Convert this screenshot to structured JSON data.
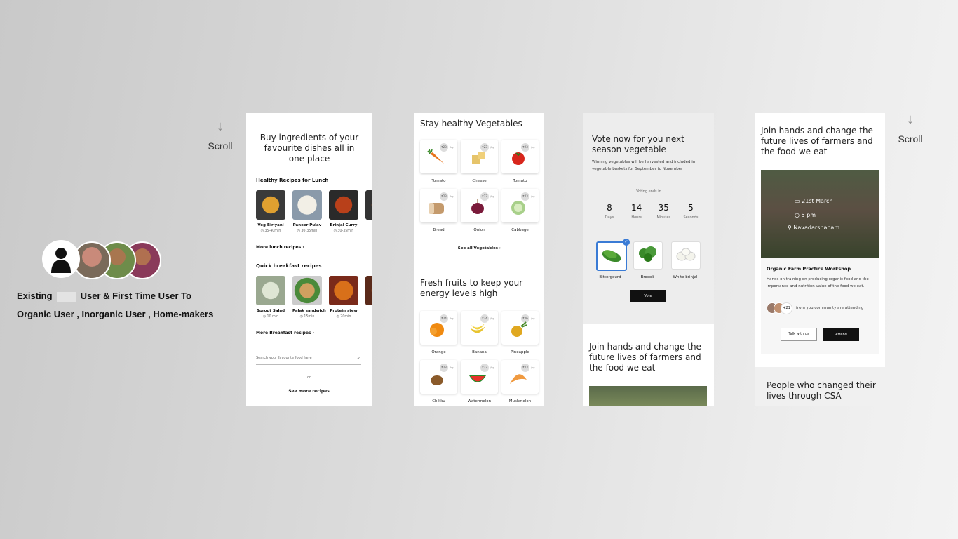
{
  "scroll_left": {
    "label": "Scroll"
  },
  "scroll_right": {
    "label": "Scroll"
  },
  "persona": {
    "line1_prefix": "Existing",
    "line1_suffix": "User & First Time User To",
    "line2": "Organic User , Inorganic User , Home-makers"
  },
  "screen1": {
    "title": "Buy ingredients of your favourite dishes all in one place",
    "lunch_title": "Healthy Recipes for Lunch",
    "lunch": [
      {
        "name": "Veg Biriyani",
        "time": "35-40min"
      },
      {
        "name": "Paneer Pulav",
        "time": "30-35min"
      },
      {
        "name": "Brinjal Curry",
        "time": "30-35min"
      },
      {
        "name": "Ve",
        "time": ""
      }
    ],
    "more_lunch": "More lunch recipes ›",
    "breakfast_title": "Quick breakfast recipes",
    "breakfast": [
      {
        "name": "Sprout Salad",
        "time": "10 min"
      },
      {
        "name": "Palak sandwich",
        "time": "15min"
      },
      {
        "name": "Protein stew",
        "time": "20min"
      },
      {
        "name": "Pr",
        "time": ""
      }
    ],
    "more_breakfast": "More Breakfast recipes ›",
    "search_placeholder": "Search your favourite food here",
    "or": "or",
    "see_more": "See more recipes"
  },
  "screen2": {
    "veg_title": "Stay healthy Vegetables",
    "vegetables": [
      {
        "name": "Tomato",
        "price": "₹23",
        "unit": "/kg",
        "icon": "carrot-icon"
      },
      {
        "name": "Cheese",
        "price": "₹23",
        "unit": "/kg",
        "icon": "cheese-icon"
      },
      {
        "name": "Tomato",
        "price": "₹23",
        "unit": "/kg",
        "icon": "tomato-icon"
      },
      {
        "name": "Bread",
        "price": "₹23",
        "unit": "/kg",
        "icon": "bread-icon"
      },
      {
        "name": "Onion",
        "price": "₹23",
        "unit": "/kg",
        "icon": "onion-icon"
      },
      {
        "name": "Cabbage",
        "price": "₹23",
        "unit": "/kg",
        "icon": "cabbage-icon"
      }
    ],
    "see_all": "See all Vegetables ›",
    "fruit_title": "Fresh fruits to keep your energy levels high",
    "fruits": [
      {
        "name": "Orange",
        "price": "₹24",
        "unit": "/kg",
        "icon": "orange-icon"
      },
      {
        "name": "Banana",
        "price": "₹24",
        "unit": "/kg",
        "icon": "banana-icon"
      },
      {
        "name": "Pineapple",
        "price": "₹26",
        "unit": "/kg",
        "icon": "pineapple-icon"
      },
      {
        "name": "Chikku",
        "price": "₹23",
        "unit": "/kg",
        "icon": "chikku-icon"
      },
      {
        "name": "Watermelon",
        "price": "₹23",
        "unit": "/kg",
        "icon": "watermelon-icon"
      },
      {
        "name": "Muskmelon",
        "price": "₹23",
        "unit": "/kg",
        "icon": "muskmelon-icon"
      }
    ]
  },
  "screen3": {
    "title": "Vote now for you next season vegetable",
    "subtitle": "Winning vegetables will be harvested and included in vegetable baskets for September to November",
    "voting_ends": "Voting ends in",
    "countdown": [
      {
        "value": "8",
        "unit": "Days"
      },
      {
        "value": "14",
        "unit": "Hours"
      },
      {
        "value": "35",
        "unit": "Minutes"
      },
      {
        "value": "5",
        "unit": "Seconds"
      }
    ],
    "options": [
      {
        "name": "Bittergourd",
        "selected": true
      },
      {
        "name": "Brocoli",
        "selected": false
      },
      {
        "name": "White brinjal",
        "selected": false
      }
    ],
    "vote": "Vote",
    "join_title": "Join hands and change the future lives of farmers and the food we eat"
  },
  "screen4": {
    "join_title": "Join hands and change the future lives of farmers and the food we eat",
    "event_date": "21st March",
    "event_time": "5 pm",
    "event_location": "Navadarshanam",
    "workshop_title": "Organic Farm Practice Workshop",
    "workshop_desc": "Hands on training on producing organic food and the importance and nutrition value of the food we eat.",
    "attendees_count": "+21",
    "attending_text": "from you community are attending",
    "talk": "Talk with us",
    "attend": "Attend",
    "people_title": "People who changed their lives through CSA"
  },
  "colors": {
    "accent": "#3a7bd5",
    "dark": "#111111"
  }
}
